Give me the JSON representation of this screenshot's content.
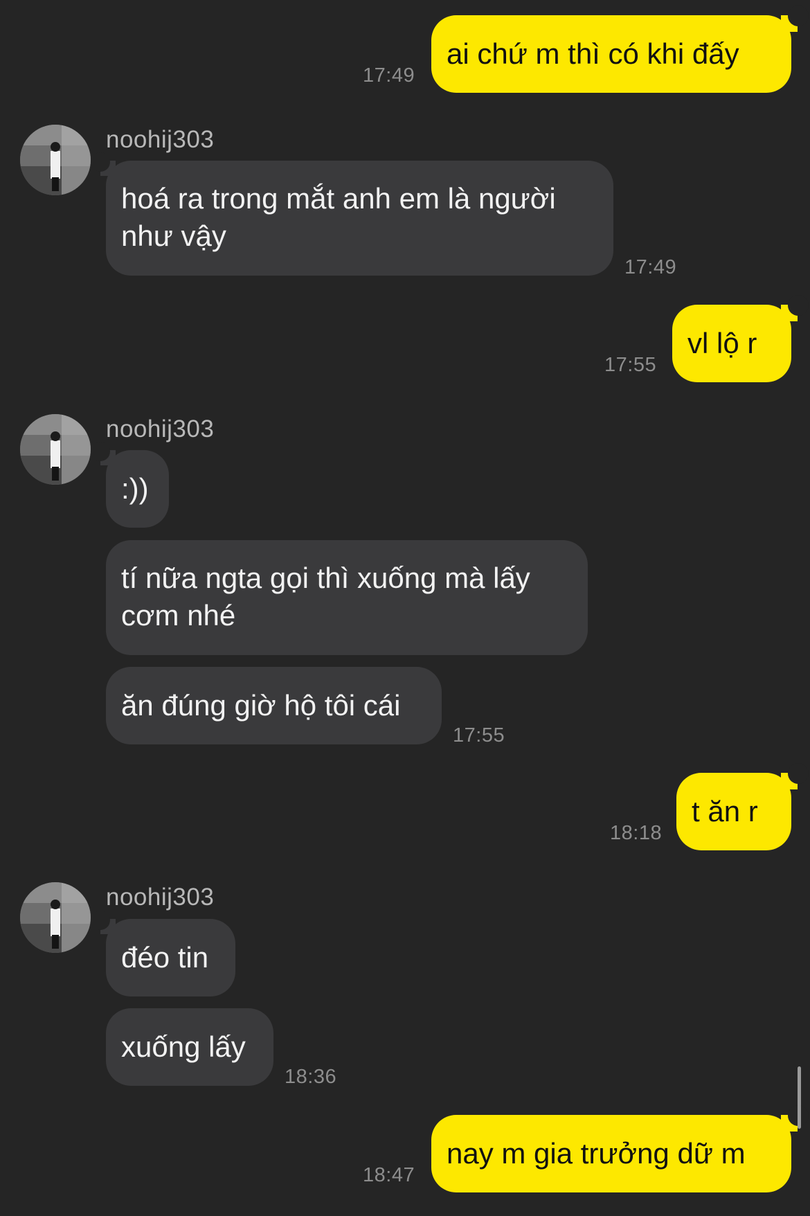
{
  "theme": {
    "background": "#252525",
    "incoming_bubble": "#3a3a3c",
    "outgoing_bubble": "#fde800",
    "timestamp_color": "#8d8d8d"
  },
  "contact": {
    "name": "noohij303",
    "avatar": "user-avatar-photo"
  },
  "messages": [
    {
      "text": "ai chứ m thì có khi đấy",
      "time": "17:49"
    },
    {
      "text": "hoá ra trong mắt anh em là người\nnhư vậy",
      "time": "17:49"
    },
    {
      "text": "vl lộ r",
      "time": "17:55"
    },
    {
      "text": ":))"
    },
    {
      "text": "tí nữa ngta gọi thì xuống mà lấy\ncơm nhé"
    },
    {
      "text": "ăn đúng giờ hộ tôi cái",
      "time": "17:55"
    },
    {
      "text": "t ăn r",
      "time": "18:18"
    },
    {
      "text": "đéo tin"
    },
    {
      "text": "xuống lấy",
      "time": "18:36"
    },
    {
      "text": "nay m gia trưởng dữ m",
      "time": "18:47"
    }
  ]
}
